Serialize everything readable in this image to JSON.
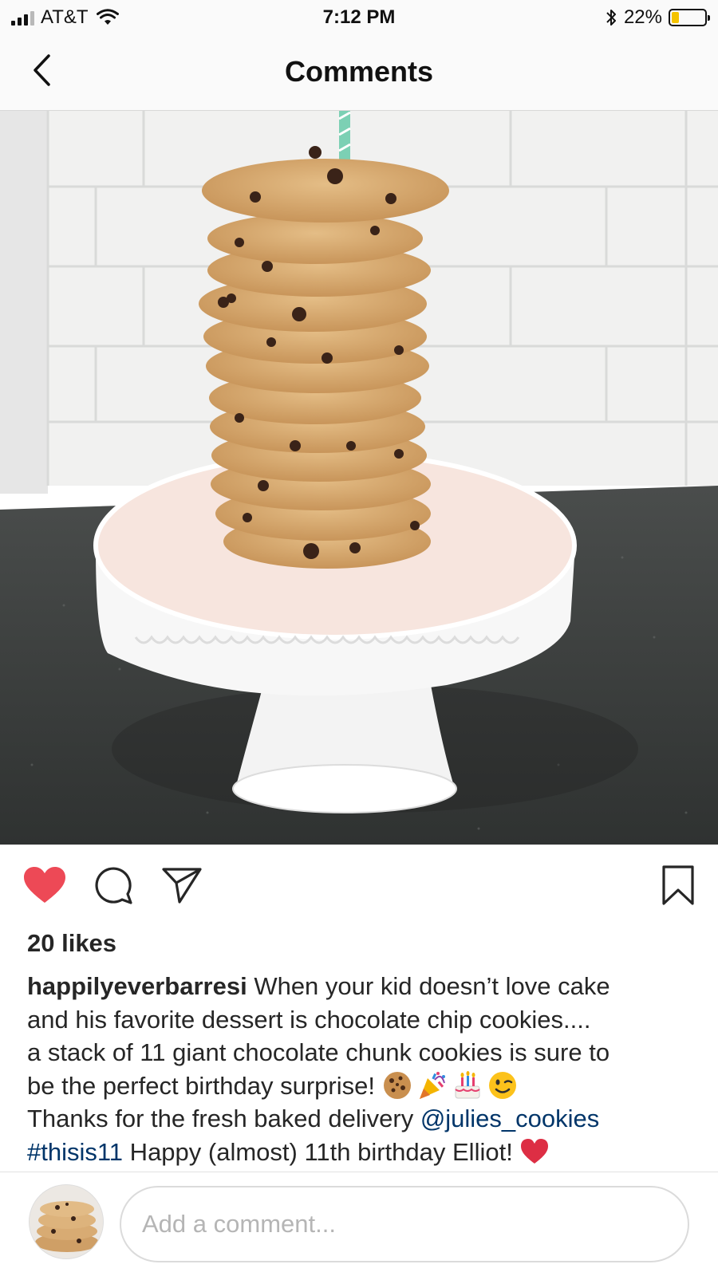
{
  "status_bar": {
    "carrier": "AT&T",
    "time": "7:12 PM",
    "battery_percent": "22%",
    "battery_level": 0.22,
    "icons": [
      "signal-icon",
      "wifi-icon",
      "bluetooth-icon",
      "battery-icon"
    ]
  },
  "nav": {
    "title": "Comments",
    "back_icon": "chevron-left-icon"
  },
  "post": {
    "photo_alt": "stack of chocolate chip cookies on a white cake stand",
    "liked": true,
    "like_color": "#ed4956",
    "likes_text": "20 likes",
    "caption": {
      "username": "happilyeverbarresi",
      "line_1": " When your kid doesn’t love cake",
      "line_2": "and his favorite dessert is chocolate chip cookies....",
      "line_3": "a stack of 11 giant chocolate chunk cookies is sure to",
      "line_4": "be the perfect birthday surprise! ",
      "emojis": [
        "cookie-emoji",
        "party-popper-emoji",
        "birthday-cake-emoji",
        "winking-face-emoji"
      ],
      "line_5": "Thanks for the fresh baked delivery ",
      "mention": "@julies_cookies",
      "hashtag": "#thisis11",
      "line_6": " Happy (almost) 11th birthday Elliot! ",
      "end_emoji": "red-heart-emoji"
    },
    "link_color": "#003569"
  },
  "comment_bar": {
    "placeholder": "Add a comment...",
    "value": ""
  }
}
